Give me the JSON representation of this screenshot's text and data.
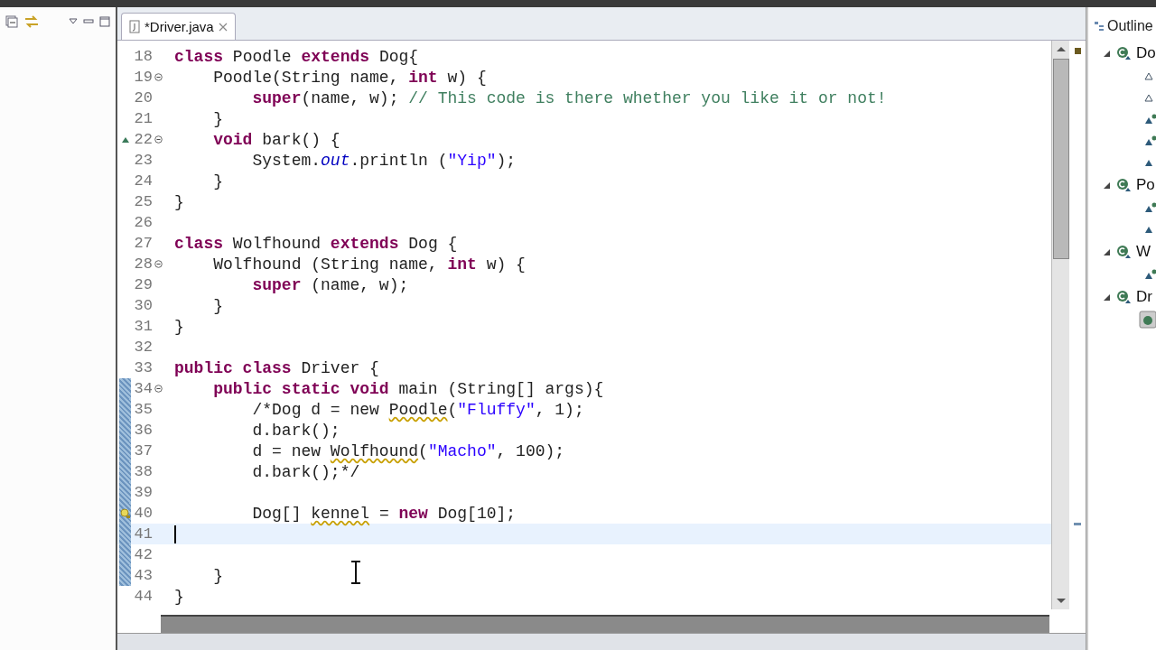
{
  "editor_tab": {
    "title": "*Driver.java"
  },
  "lines": [
    {
      "number": "18",
      "segments": [
        {
          "kind": "kw",
          "text": "class"
        },
        {
          "text": " Poodle "
        },
        {
          "kind": "kw",
          "text": "extends"
        },
        {
          "text": " Dog{"
        }
      ]
    },
    {
      "number": "19",
      "fold": true,
      "segments": [
        {
          "text": "    Poodle(String name, "
        },
        {
          "kind": "kw",
          "text": "int"
        },
        {
          "text": " w) {"
        }
      ]
    },
    {
      "number": "20",
      "segments": [
        {
          "kind": "kw",
          "text": "        super"
        },
        {
          "text": "(name, w); "
        },
        {
          "kind": "comment",
          "text": "// This code is there whether you like it or not!"
        }
      ]
    },
    {
      "number": "21",
      "segments": [
        {
          "text": "    }"
        }
      ]
    },
    {
      "number": "22",
      "fold": true,
      "override": true,
      "segments": [
        {
          "kind": "kw",
          "text": "    void"
        },
        {
          "text": " bark() {"
        }
      ]
    },
    {
      "number": "23",
      "segments": [
        {
          "text": "        System."
        },
        {
          "kind": "field",
          "text": "out"
        },
        {
          "text": ".println ("
        },
        {
          "kind": "string",
          "text": "\"Yip\""
        },
        {
          "text": ");"
        }
      ]
    },
    {
      "number": "24",
      "segments": [
        {
          "text": "    }"
        }
      ]
    },
    {
      "number": "25",
      "segments": [
        {
          "text": "}"
        }
      ]
    },
    {
      "number": "26"
    },
    {
      "number": "27",
      "segments": [
        {
          "kind": "kw",
          "text": "class"
        },
        {
          "text": " Wolfhound "
        },
        {
          "kind": "kw",
          "text": "extends"
        },
        {
          "text": " Dog {"
        }
      ]
    },
    {
      "number": "28",
      "fold": true,
      "segments": [
        {
          "text": "    Wolfhound (String name, "
        },
        {
          "kind": "kw",
          "text": "int"
        },
        {
          "text": " w) {"
        }
      ]
    },
    {
      "number": "29",
      "segments": [
        {
          "kind": "kw",
          "text": "        super"
        },
        {
          "text": " (name, w);"
        }
      ]
    },
    {
      "number": "30",
      "segments": [
        {
          "text": "    }"
        }
      ]
    },
    {
      "number": "31",
      "segments": [
        {
          "text": "}"
        }
      ]
    },
    {
      "number": "32"
    },
    {
      "number": "33",
      "segments": [
        {
          "kind": "kw",
          "text": "public class"
        },
        {
          "text": " Driver {"
        }
      ]
    },
    {
      "number": "34",
      "fold": true,
      "changed": true,
      "segments": [
        {
          "kind": "kw",
          "text": "    public static void"
        },
        {
          "text": " main (String[] args){"
        }
      ]
    },
    {
      "number": "35",
      "changed": true,
      "segments": [
        {
          "text": "        /*Dog d = new "
        },
        {
          "kind": "warn",
          "text": "Poodle"
        },
        {
          "text": "("
        },
        {
          "kind": "string",
          "text": "\"Fluffy\""
        },
        {
          "text": ", 1);"
        }
      ]
    },
    {
      "number": "36",
      "changed": true,
      "segments": [
        {
          "text": "        d.bark();"
        }
      ]
    },
    {
      "number": "37",
      "changed": true,
      "segments": [
        {
          "text": "        d = new "
        },
        {
          "kind": "warn",
          "text": "Wolfhound"
        },
        {
          "text": "("
        },
        {
          "kind": "string",
          "text": "\"Macho\""
        },
        {
          "text": ", 100);"
        }
      ]
    },
    {
      "number": "38",
      "changed": true,
      "segments": [
        {
          "text": "        d.bark();*/"
        }
      ]
    },
    {
      "number": "39",
      "changed": true
    },
    {
      "number": "40",
      "changed": true,
      "warning": true,
      "segments": [
        {
          "text": "        Dog[] "
        },
        {
          "kind": "warn",
          "text": "kennel"
        },
        {
          "text": " = "
        },
        {
          "kind": "kw",
          "text": "new"
        },
        {
          "text": " Dog[10];"
        }
      ]
    },
    {
      "number": "41",
      "changed": true,
      "current": true
    },
    {
      "number": "42",
      "changed": true
    },
    {
      "number": "43",
      "changed": true,
      "segments": [
        {
          "text": "    }"
        }
      ]
    },
    {
      "number": "44",
      "segments": [
        {
          "text": "}"
        }
      ]
    }
  ],
  "outline": {
    "title": "Outline",
    "classes": [
      {
        "label": "Do",
        "children": [
          {
            "kind": "field"
          },
          {
            "kind": "field"
          },
          {
            "kind": "constructor"
          },
          {
            "kind": "constructor"
          },
          {
            "kind": "method"
          }
        ]
      },
      {
        "label": "Po",
        "children": [
          {
            "kind": "constructor"
          },
          {
            "kind": "method"
          }
        ]
      },
      {
        "label": "W",
        "children": [
          {
            "kind": "constructor"
          }
        ]
      },
      {
        "label": "Dr",
        "children": [
          {
            "kind": "main"
          }
        ]
      }
    ]
  }
}
